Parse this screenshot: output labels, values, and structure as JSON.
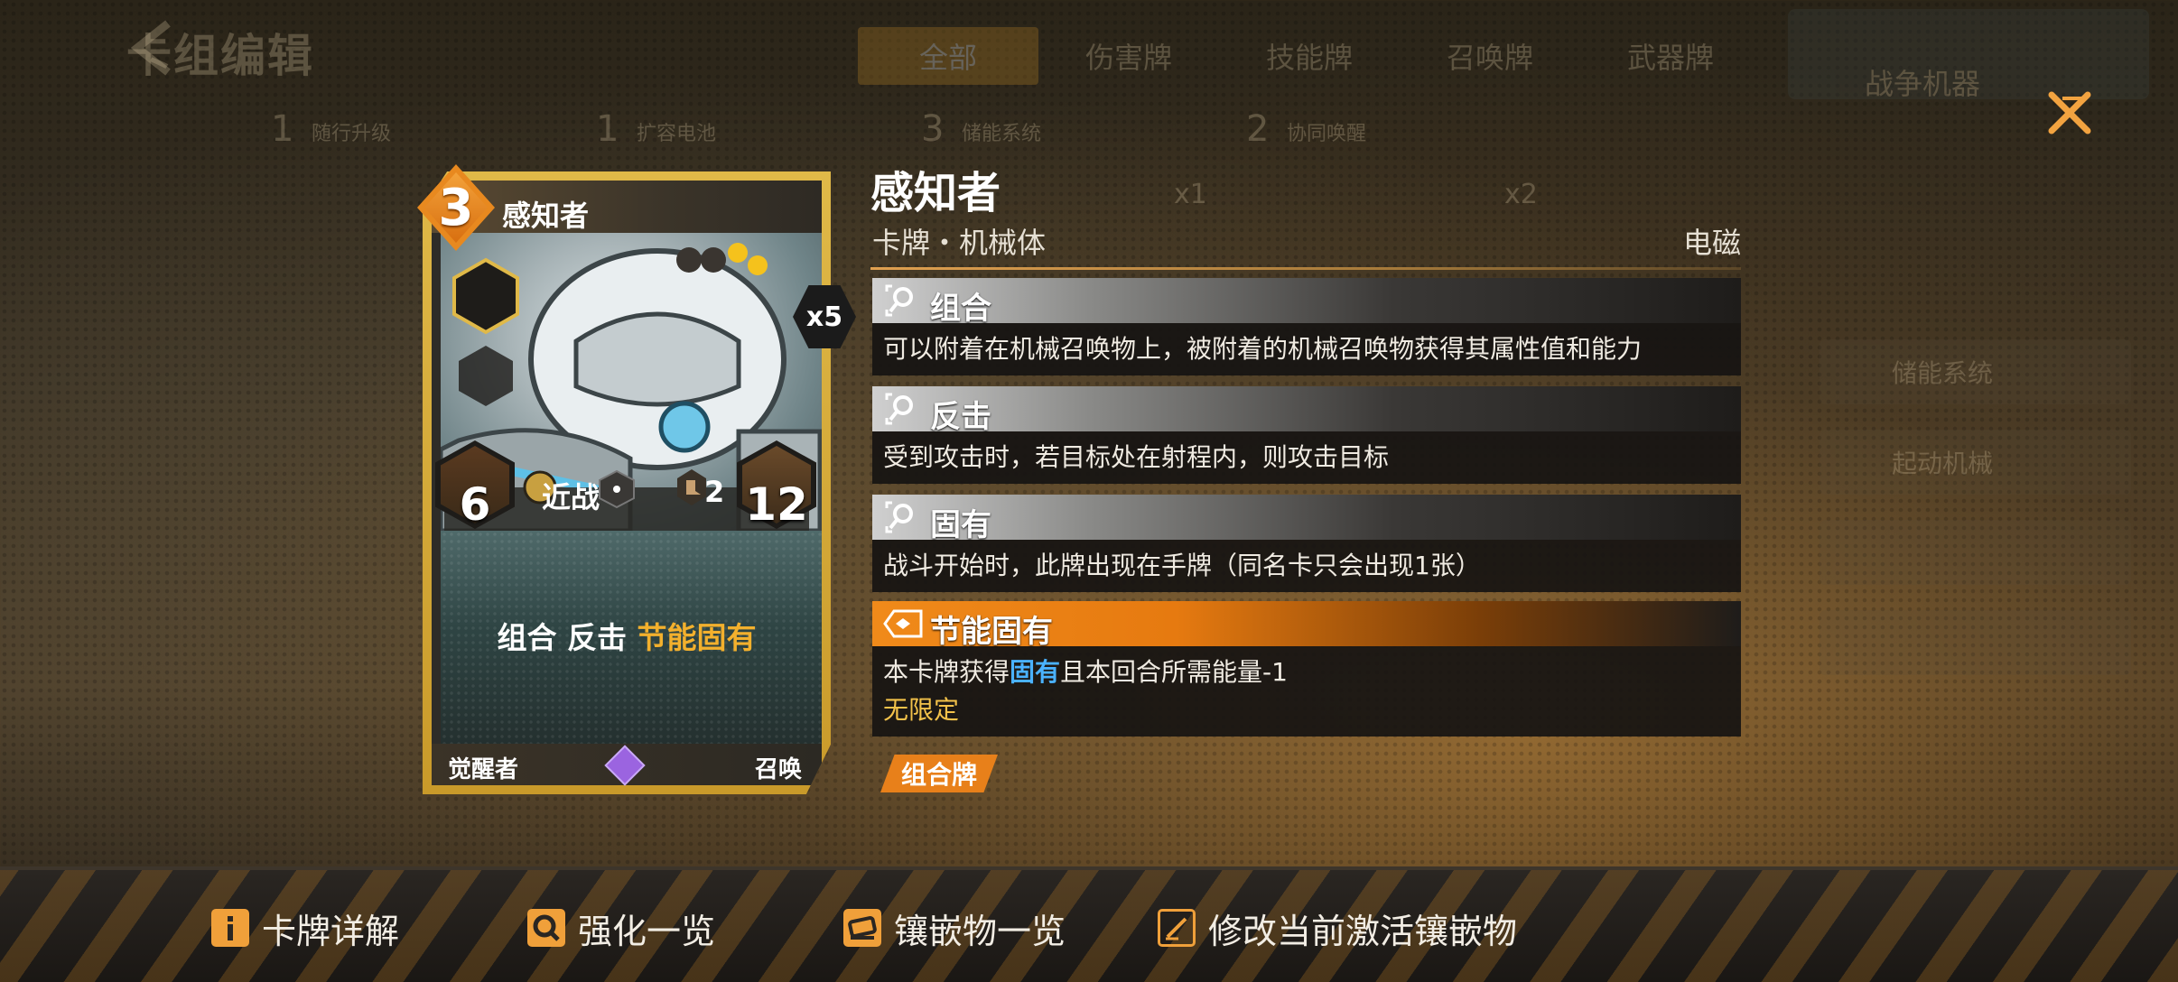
{
  "background": {
    "title": "卡组编辑",
    "tabs": [
      "全部",
      "伤害牌",
      "技能牌",
      "召唤牌",
      "武器牌"
    ],
    "slots": [
      {
        "cost": "1",
        "label": "随行升级"
      },
      {
        "cost": "1",
        "label": "扩容电池"
      },
      {
        "cost": "3",
        "label": "储能系统"
      },
      {
        "cost": "2",
        "label": "协同唤醒"
      }
    ],
    "counts": [
      "x1",
      "x2"
    ],
    "right_panel_title": "战争机器",
    "right_items": [
      "储能系统",
      "起动机械",
      "",
      ""
    ]
  },
  "card": {
    "cost": "3",
    "name": "感知者",
    "attack": "6",
    "attack_type": "近战",
    "range": "2",
    "health": "12",
    "copies": "x5",
    "keywords": {
      "white": "组合 反击",
      "gold": "节能固有"
    },
    "footer_left": "觉醒者",
    "footer_right": "召唤",
    "colors": {
      "frame": "#e0b948",
      "cost": "#e8891f",
      "gem": "#9b64e0"
    }
  },
  "details": {
    "title": "感知者",
    "subtitle": "卡牌・机械体",
    "element": "电磁",
    "abilities": [
      {
        "name": "组合",
        "desc": "可以附着在机械召唤物上，被附着的机械召唤物获得其属性值和能力",
        "style": "grey"
      },
      {
        "name": "反击",
        "desc": "受到攻击时，若目标处在射程内，则攻击目标",
        "style": "grey"
      },
      {
        "name": "固有",
        "desc": "战斗开始时，此牌出现在手牌（同名卡只会出现1张）",
        "style": "grey"
      }
    ],
    "special": {
      "name": "节能固有",
      "desc_prefix": "本卡牌获得",
      "desc_highlight": "固有",
      "desc_suffix": "且本回合所需能量-1",
      "limit": "无限定"
    },
    "tag": "组合牌"
  },
  "bottom_bar": {
    "items": [
      {
        "icon": "info-icon",
        "label": "卡牌详解"
      },
      {
        "icon": "magnifier-icon",
        "label": "强化一览"
      },
      {
        "icon": "inlay-icon",
        "label": "镶嵌物一览"
      },
      {
        "icon": "edit-icon",
        "label": "修改当前激活镶嵌物"
      }
    ]
  }
}
